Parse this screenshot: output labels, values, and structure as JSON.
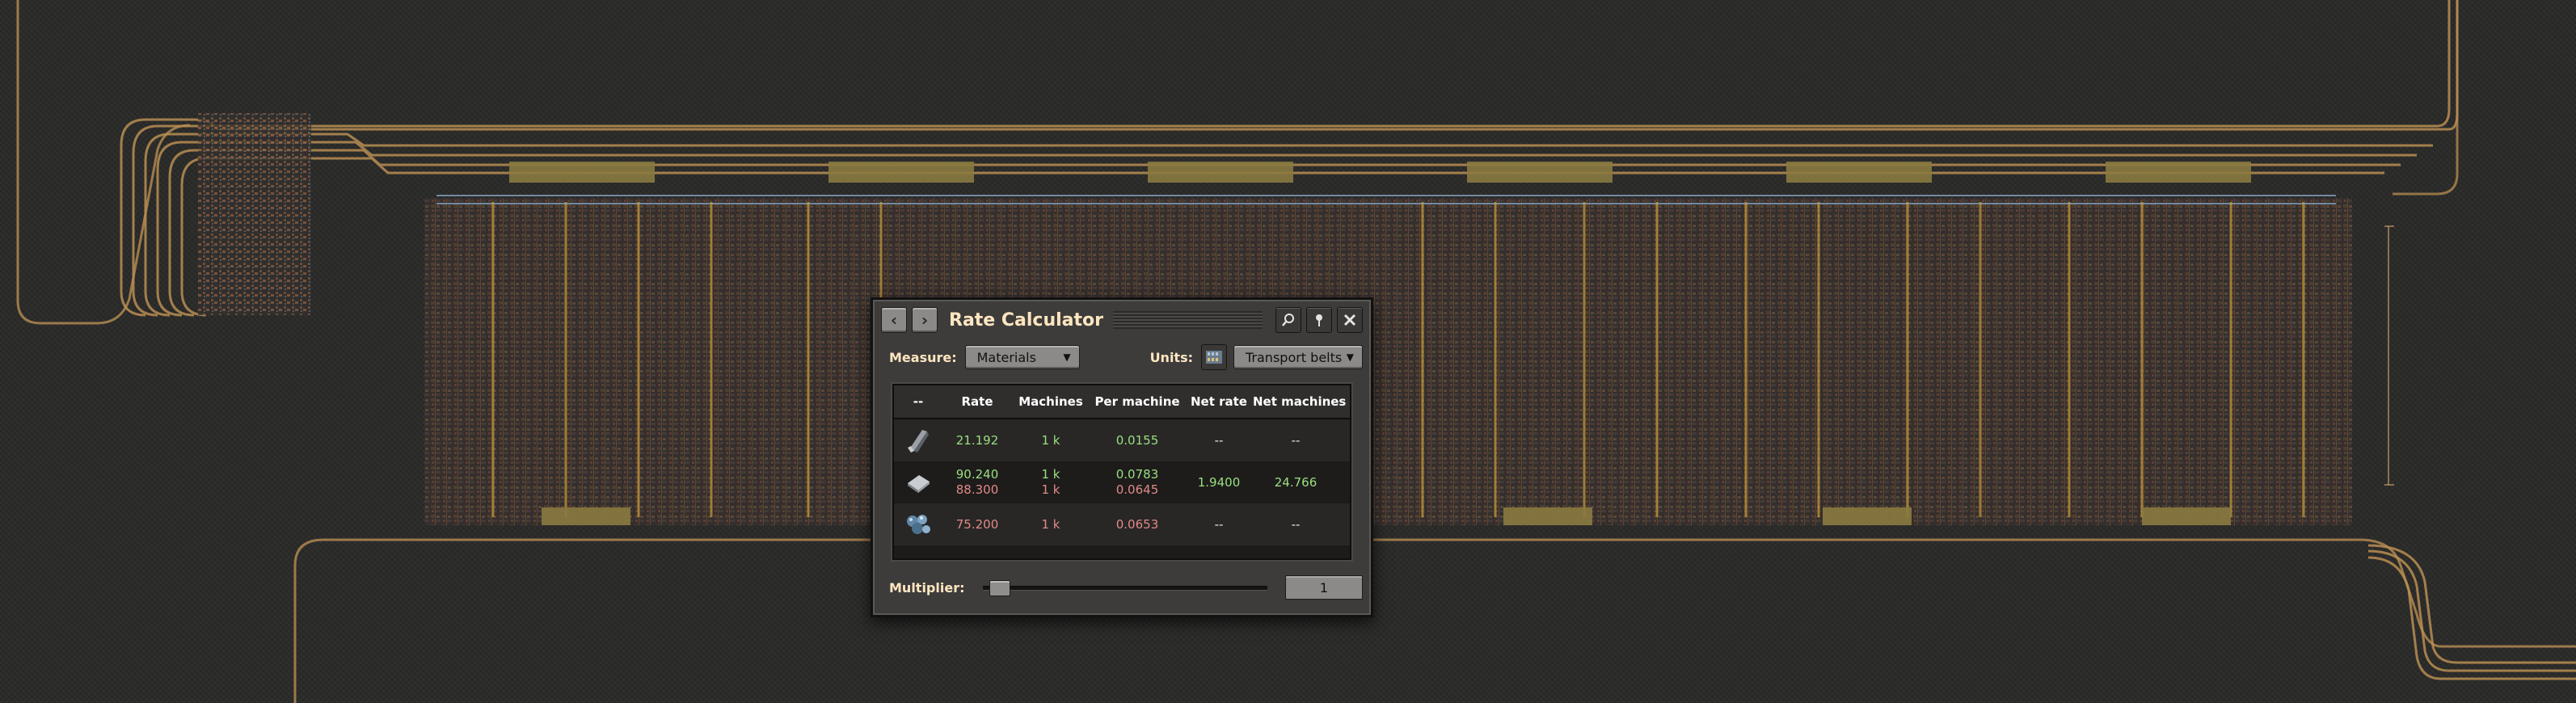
{
  "window": {
    "title": "Rate Calculator",
    "nav": {
      "back_icon": "chevron-left-icon",
      "forward_icon": "chevron-right-icon"
    },
    "title_buttons": [
      "search-icon",
      "pin-icon",
      "close-icon"
    ]
  },
  "controls": {
    "measure_label": "Measure:",
    "measure_value": "Materials",
    "units_label": "Units:",
    "units_icon": "transport-belt-icon",
    "units_value": "Transport belts"
  },
  "table": {
    "headers": [
      "--",
      "Rate",
      "Machines",
      "Per machine",
      "Net rate",
      "Net machines"
    ],
    "rows": [
      {
        "icon": "iron-gear-wheel-icon",
        "rate": "21.192",
        "machines": "1 k",
        "per_machine": "0.0155",
        "net_rate": "--",
        "net_machines": "--"
      },
      {
        "icon": "iron-plate-icon",
        "rate": "90.240",
        "rate_consumed": "88.300",
        "machines": "1 k",
        "machines_consumed": "1 k",
        "per_machine": "0.0783",
        "per_machine_consumed": "0.0645",
        "net_rate": "1.9400",
        "net_machines": "24.766"
      },
      {
        "icon": "iron-ore-icon",
        "rate": "75.200",
        "machines": "1 k",
        "per_machine": "0.0653",
        "net_rate": "--",
        "net_machines": "--"
      }
    ]
  },
  "footer": {
    "multiplier_label": "Multiplier:",
    "multiplier_value": "1",
    "slider_fraction": 0.0
  },
  "colors": {
    "produced": "#9adf7f",
    "consumed": "#e08a87",
    "belt_rail": "#b98e52",
    "belt_blue": "#7f9ab4",
    "heading": "#ffe6c0"
  }
}
